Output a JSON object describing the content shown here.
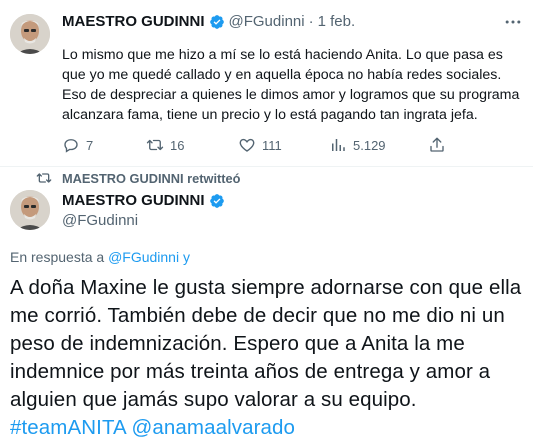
{
  "tweet1": {
    "display_name": "MAESTRO GUDINNI",
    "handle": "@FGudinni",
    "separator": "·",
    "date": "1 feb.",
    "text": "Lo mismo que me hizo a mí se lo está haciendo Anita. Lo que pasa es que yo me quedé callado y en aquella época no había redes sociales. Eso de despreciar a quienes le dimos amor y logramos que su programa alcanzara fama, tiene un precio y lo está pagando tan ingrata jefa.",
    "actions": {
      "replies": "7",
      "retweets": "16",
      "likes": "111",
      "views": "5.129"
    }
  },
  "retweet_banner": {
    "text": "MAESTRO GUDINNI retwitteó"
  },
  "tweet2": {
    "display_name": "MAESTRO GUDINNI",
    "handle": "@FGudinni",
    "reply_prefix": "En respuesta a",
    "reply_users": "@FGudinni y",
    "text_main": "A doña Maxine le gusta siempre adornarse con que ella me corrió. También debe de decir que no me dio ni un peso de indemnización. Espero que a Anita la me indemnice por más treinta años de entrega y amor a alguien que jamás supo valorar a su equipo.",
    "hashtag": "#teamANITA",
    "mention": "@anamaalvarado"
  },
  "colors": {
    "verified": "#1d9bf0",
    "link": "#1d9bf0",
    "muted": "#536471"
  },
  "icons": [
    "verified-badge-icon",
    "more-options-icon",
    "reply-icon",
    "retweet-icon",
    "like-icon",
    "views-icon",
    "share-icon"
  ]
}
